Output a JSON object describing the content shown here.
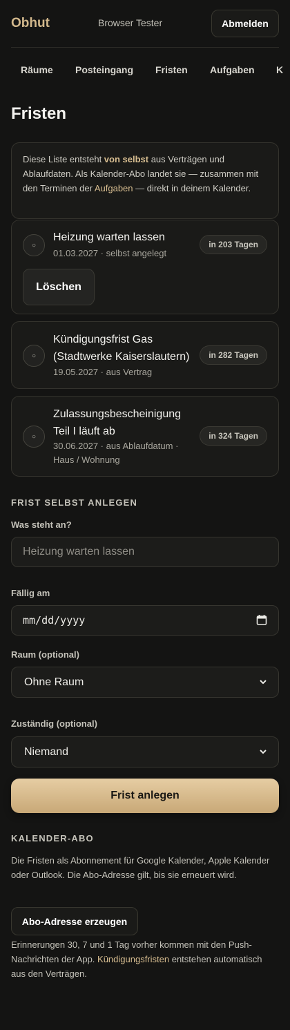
{
  "header": {
    "logo": "Obhut",
    "user": "Browser Tester",
    "logout_label": "Abmelden"
  },
  "nav": {
    "items": [
      "Räume",
      "Posteingang",
      "Fristen",
      "Aufgaben",
      "K"
    ]
  },
  "page": {
    "title": "Fristen"
  },
  "info": {
    "t1": "Diese Liste entsteht ",
    "b1": "von selbst",
    "t2": " aus Verträgen und Ablaufdaten. Als Kalender-Abo landet sie — zusammen mit den Terminen der ",
    "link": "Aufgaben",
    "t3": " — direkt in deinem Kalender."
  },
  "deadlines": [
    {
      "title": "Heizung warten lassen",
      "meta": "01.03.2027 · selbst angelegt",
      "badge": "in 203 Tagen",
      "delete_label": "Löschen"
    },
    {
      "title": "Kündigungsfrist Gas (Stadtwerke Kaiserslautern)",
      "meta": "19.05.2027 · aus Vertrag",
      "badge": "in 282 Tagen"
    },
    {
      "title": "Zulassungsbescheinigung Teil I läuft ab",
      "meta": "30.06.2027 · aus Ablaufdatum · Haus / Wohnung",
      "badge": "in 324 Tagen"
    }
  ],
  "form": {
    "heading": "FRIST SELBST ANLEGEN",
    "what_label": "Was steht an?",
    "what_placeholder": "Heizung warten lassen",
    "due_label": "Fällig am",
    "due_value": "mm/dd/yyyy",
    "room_label": "Raum (optional)",
    "room_value": "Ohne Raum",
    "owner_label": "Zuständig (optional)",
    "owner_value": "Niemand",
    "submit_label": "Frist anlegen"
  },
  "calendar": {
    "heading": "KALENDER-ABO",
    "text": "Die Fristen als Abonnement für Google Kalender, Apple Kalender oder Outlook. Die Abo-Adresse gilt, bis sie erneuert wird.",
    "button_label": "Abo-Adresse erzeugen",
    "note_t1": "Erinnerungen 30, 7 und 1 Tag vorher kommen mit den Push-Nachrichten der App. ",
    "note_link": "Kündigungsfristen",
    "note_t2": " entstehen automatisch aus den Verträgen."
  },
  "icons": {
    "status_circle": "circle-icon",
    "calendar": "calendar-icon",
    "chevron": "chevron-down-icon"
  },
  "colors": {
    "background": "#141413",
    "accent": "#d8be91",
    "button_gradient_top": "#e6cda3",
    "button_gradient_bottom": "#c8a877"
  }
}
